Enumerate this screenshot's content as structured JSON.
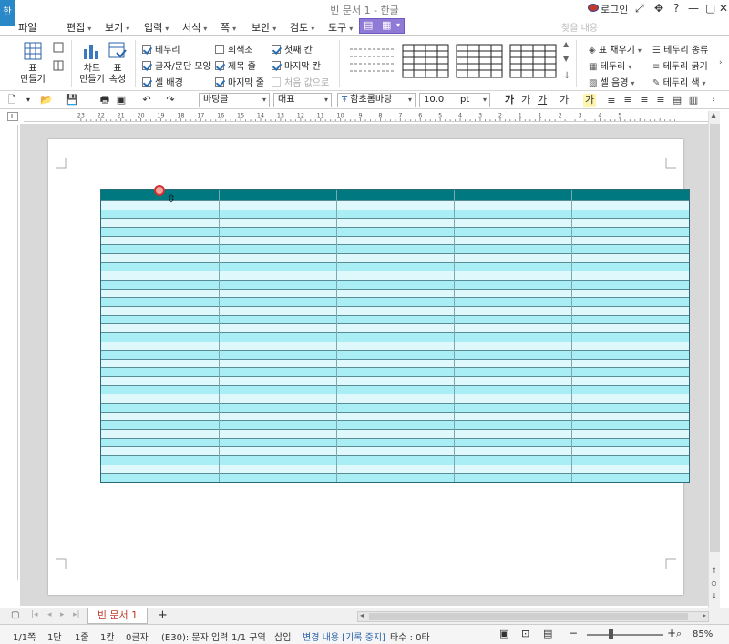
{
  "app": {
    "icon_label": "한",
    "title": "빈 문서 1 - 한글",
    "login": "로그인",
    "search_placeholder": "찾을 내용"
  },
  "menu": {
    "items": [
      "파일",
      "편집",
      "보기",
      "입력",
      "서식",
      "쪽",
      "보안",
      "검토",
      "도구"
    ]
  },
  "ribbon": {
    "table_make": "표\n만들기",
    "chart_make": "차트\n만들기",
    "table_props": "표\n속성",
    "checks_col1": [
      {
        "label": "테두리",
        "checked": true
      },
      {
        "label": "글자/문단 모양",
        "checked": true
      },
      {
        "label": "셀 배경",
        "checked": true
      }
    ],
    "checks_col2": [
      {
        "label": "회색조",
        "checked": false
      },
      {
        "label": "제목 줄",
        "checked": true
      },
      {
        "label": "마지막 줄",
        "checked": true
      }
    ],
    "checks_col3": [
      {
        "label": "첫째 칸",
        "checked": true
      },
      {
        "label": "마지막 칸",
        "checked": true
      },
      {
        "label": "처음 값으로",
        "checked": false,
        "disabled": true
      }
    ],
    "right_col1": [
      "표 채우기",
      "테두리",
      "셀 음영"
    ],
    "right_col2": [
      "테두리 종류",
      "테두리 굵기",
      "테두리 색"
    ]
  },
  "toolbar": {
    "style_select": "바탕글",
    "style_group": "대표",
    "font_select": "함초롬바탕",
    "font_size": "10.0",
    "font_unit": "pt"
  },
  "ruler": {
    "labels": [
      "23",
      "22",
      "21",
      "20",
      "19",
      "18",
      "17",
      "16",
      "15",
      "14",
      "13",
      "12",
      "11",
      "10",
      "9",
      "8",
      "7",
      "6",
      "5",
      "4",
      "3",
      "2",
      "1",
      "1",
      "2",
      "3",
      "4",
      "5"
    ]
  },
  "tabs": {
    "doc_tab": "빈 문서 1",
    "add": "+"
  },
  "status": {
    "page": "1/1쪽",
    "column": "1단",
    "line": "1줄",
    "cell": "1칸",
    "chars": "0글자",
    "cell_mode": "(E30): 문자 입력",
    "section": "1/1 구역",
    "insert": "삽입",
    "track": "변경 내용 [기록 중지]",
    "strokes": "타수 : 0타",
    "zoom": "85%"
  },
  "table": {
    "columns": 5,
    "rows": 33
  }
}
